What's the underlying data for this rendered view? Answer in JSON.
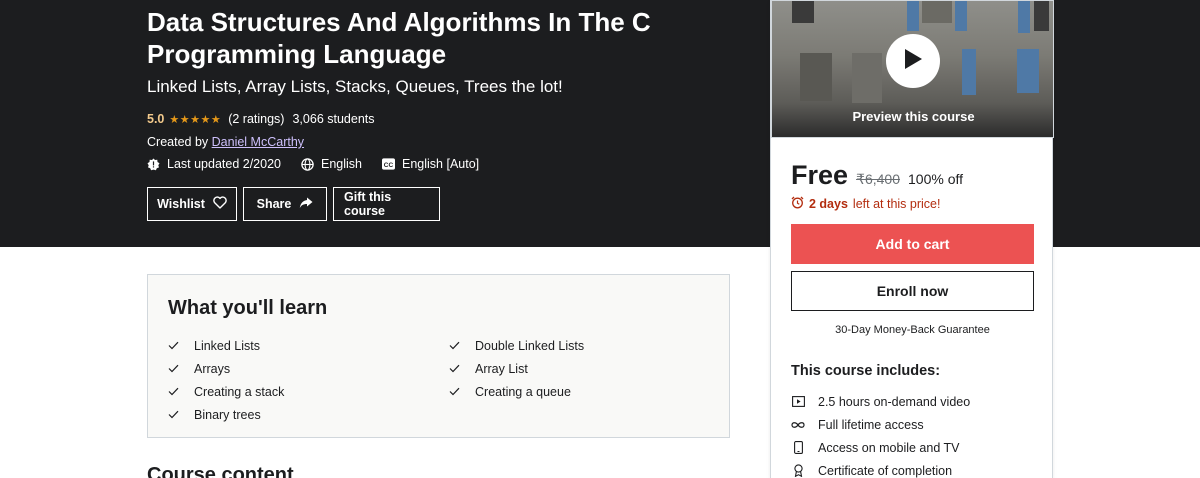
{
  "course": {
    "title": "Data Structures And Algorithms In The C Programming Language",
    "subtitle": "Linked Lists, Array Lists, Stacks, Queues, Trees the lot!",
    "rating": "5.0",
    "stars": "★★★★★",
    "ratings_count": "(2 ratings)",
    "students": "3,066 students",
    "created_label": "Created by",
    "instructor": "Daniel McCarthy",
    "last_updated": "Last updated 2/2020",
    "language": "English",
    "captions": "English [Auto]"
  },
  "actions": {
    "wishlist": "Wishlist",
    "share": "Share",
    "gift": "Gift this course"
  },
  "sidebar": {
    "preview_label": "Preview this course",
    "price": "Free",
    "original_price": "₹6,400",
    "discount": "100% off",
    "timer_bold": "2 days",
    "timer_rest": "left at this price!",
    "add_to_cart": "Add to cart",
    "enroll_now": "Enroll now",
    "guarantee": "30-Day Money-Back Guarantee",
    "includes_title": "This course includes:",
    "includes": [
      {
        "icon": "video-icon",
        "label": "2.5 hours on-demand video"
      },
      {
        "icon": "infinity-icon",
        "label": "Full lifetime access"
      },
      {
        "icon": "mobile-icon",
        "label": "Access on mobile and TV"
      },
      {
        "icon": "certificate-icon",
        "label": "Certificate of completion"
      }
    ]
  },
  "learn": {
    "title": "What you'll learn",
    "left": [
      "Linked Lists",
      "Arrays",
      "Creating a stack",
      "Binary trees"
    ],
    "right": [
      "Double Linked Lists",
      "Array List",
      "Creating a queue"
    ]
  },
  "course_content_title": "Course content",
  "colors": {
    "hero_bg": "#1c1d1f",
    "rating": "#f3ca8c",
    "stars": "#e59819",
    "link": "#cec0fc",
    "cart": "#ec5252",
    "timer": "#b32d0f"
  }
}
